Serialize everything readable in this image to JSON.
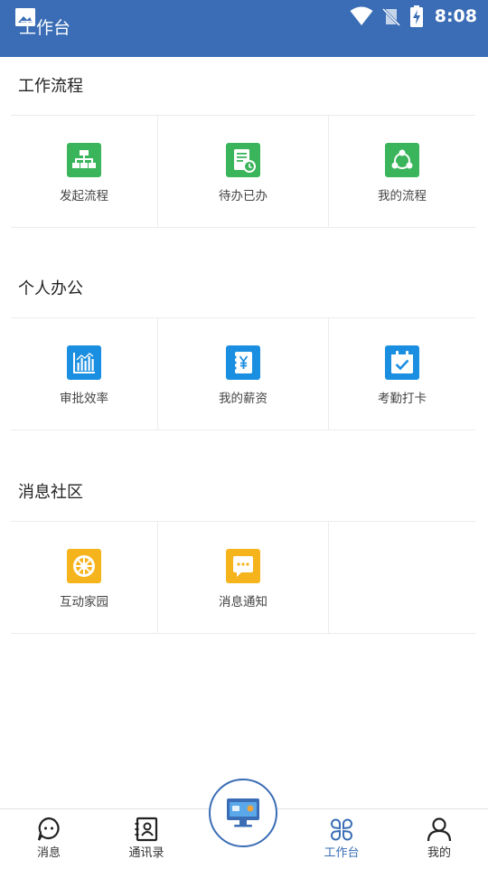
{
  "header": {
    "title": "工作台",
    "time": "8:08"
  },
  "sections": [
    {
      "title": "工作流程",
      "items": [
        {
          "label": "发起流程",
          "icon": "org-chart-icon",
          "color": "#3ab55b"
        },
        {
          "label": "待办已办",
          "icon": "document-clock-icon",
          "color": "#3ab55b"
        },
        {
          "label": "我的流程",
          "icon": "share-cycle-icon",
          "color": "#3ab55b"
        }
      ]
    },
    {
      "title": "个人办公",
      "items": [
        {
          "label": "审批效率",
          "icon": "bar-chart-icon",
          "color": "#1a8ee0"
        },
        {
          "label": "我的薪资",
          "icon": "yen-icon",
          "color": "#1a8ee0"
        },
        {
          "label": "考勤打卡",
          "icon": "calendar-check-icon",
          "color": "#1a8ee0"
        }
      ]
    },
    {
      "title": "消息社区",
      "items": [
        {
          "label": "互动家园",
          "icon": "wheel-icon",
          "color": "#f5b31c"
        },
        {
          "label": "消息通知",
          "icon": "chat-bubble-icon",
          "color": "#f5b31c"
        }
      ]
    }
  ],
  "tabs": [
    {
      "label": "消息",
      "icon": "chat-icon"
    },
    {
      "label": "通讯录",
      "icon": "contacts-icon"
    },
    {
      "label": "工作台",
      "icon": "grid-icon",
      "active": true
    },
    {
      "label": "我的",
      "icon": "person-icon"
    }
  ],
  "colors": {
    "primary": "#3a6db5",
    "green": "#3ab55b",
    "blue": "#1a8ee0",
    "yellow": "#f5b31c"
  }
}
